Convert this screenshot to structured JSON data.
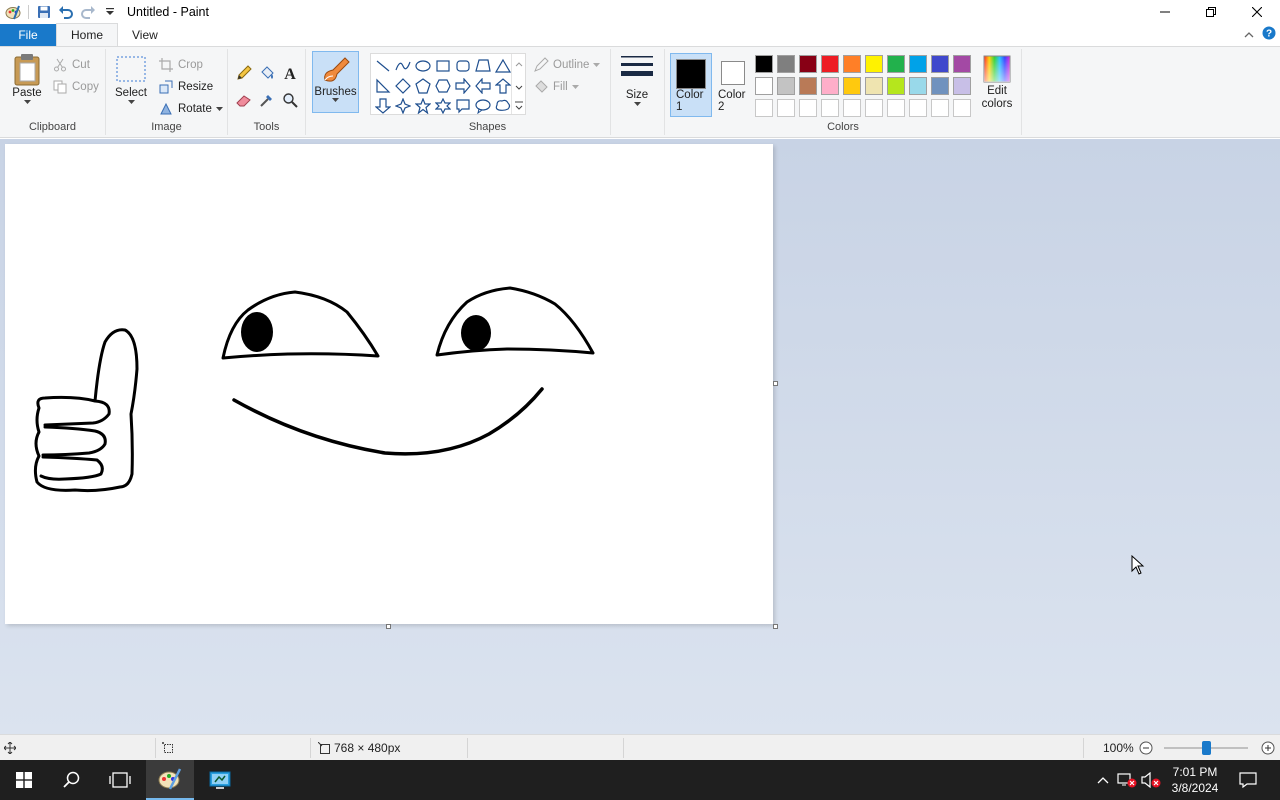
{
  "window": {
    "title": "Untitled - Paint"
  },
  "tabs": {
    "file": "File",
    "home": "Home",
    "view": "View"
  },
  "clipboard": {
    "paste": "Paste",
    "cut": "Cut",
    "copy": "Copy",
    "group": "Clipboard"
  },
  "image": {
    "select": "Select",
    "crop": "Crop",
    "resize": "Resize",
    "rotate": "Rotate",
    "group": "Image"
  },
  "tools": {
    "group": "Tools"
  },
  "brushes": {
    "label": "Brushes"
  },
  "shapes": {
    "group": "Shapes",
    "outline": "Outline",
    "fill": "Fill"
  },
  "size": {
    "label": "Size"
  },
  "colors": {
    "color1": "Color 1",
    "color2": "Color 2",
    "edit": "Edit colors",
    "group": "Colors",
    "color1_value": "#000000",
    "color2_value": "#ffffff",
    "palette_row1": [
      "#000000",
      "#7f7f7f",
      "#880015",
      "#ed1c24",
      "#ff7f27",
      "#fff200",
      "#22b14c",
      "#00a2e8",
      "#3f48cc",
      "#a349a4"
    ],
    "palette_row2": [
      "#ffffff",
      "#c3c3c3",
      "#b97a57",
      "#ffaec9",
      "#ffc90e",
      "#efe4b0",
      "#b5e61d",
      "#99d9ea",
      "#7092be",
      "#c8bfe7"
    ]
  },
  "status": {
    "canvas_size": "768 × 480px",
    "zoom": "100%"
  },
  "taskbar": {
    "time": "7:01 PM",
    "date": "3/8/2024"
  }
}
